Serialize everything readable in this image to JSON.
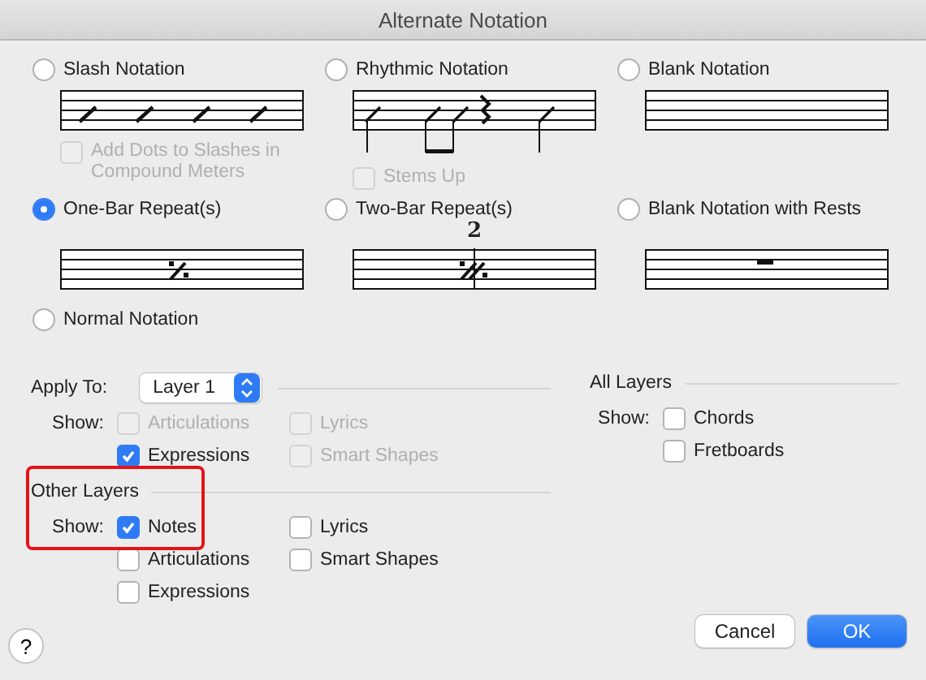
{
  "window": {
    "title": "Alternate Notation"
  },
  "notation_options": [
    {
      "label": "Slash Notation",
      "selected": false,
      "kind": "slash",
      "option": {
        "label": "Add Dots to Slashes in Compound Meters",
        "checked": false,
        "disabled": true
      }
    },
    {
      "label": "Rhythmic Notation",
      "selected": false,
      "kind": "rhythmic",
      "option": {
        "label": "Stems Up",
        "checked": false,
        "disabled": true
      }
    },
    {
      "label": "Blank Notation",
      "selected": false,
      "kind": "blank"
    },
    {
      "label": "One-Bar Repeat(s)",
      "selected": true,
      "kind": "one_bar"
    },
    {
      "label": "Two-Bar Repeat(s)",
      "selected": false,
      "kind": "two_bar",
      "staff_number": "2"
    },
    {
      "label": "Blank Notation with Rests",
      "selected": false,
      "kind": "rests"
    },
    {
      "label": "Normal Notation",
      "selected": false,
      "kind": "none"
    }
  ],
  "apply_to": {
    "label": "Apply To:",
    "value": "Layer 1"
  },
  "layer_show": {
    "label": "Show:",
    "items": [
      {
        "label": "Articulations",
        "checked": false,
        "disabled": true
      },
      {
        "label": "Lyrics",
        "checked": false,
        "disabled": true
      },
      {
        "label": "Expressions",
        "checked": true,
        "disabled": false
      },
      {
        "label": "Smart Shapes",
        "checked": false,
        "disabled": true
      }
    ]
  },
  "other_layers": {
    "title": "Other Layers",
    "highlighted": true,
    "show_label": "Show:",
    "items": [
      {
        "label": "Notes",
        "checked": true,
        "disabled": false
      },
      {
        "label": "Lyrics",
        "checked": false,
        "disabled": false
      },
      {
        "label": "Articulations",
        "checked": false,
        "disabled": false
      },
      {
        "label": "Smart Shapes",
        "checked": false,
        "disabled": false
      },
      {
        "label": "Expressions",
        "checked": false,
        "disabled": false
      }
    ]
  },
  "all_layers": {
    "title": "All Layers",
    "show_label": "Show:",
    "items": [
      {
        "label": "Chords",
        "checked": false,
        "disabled": false
      },
      {
        "label": "Fretboards",
        "checked": false,
        "disabled": false
      }
    ]
  },
  "help": "?",
  "buttons": [
    {
      "label": "Cancel",
      "kind": "default"
    },
    {
      "label": "OK",
      "kind": "primary"
    }
  ]
}
